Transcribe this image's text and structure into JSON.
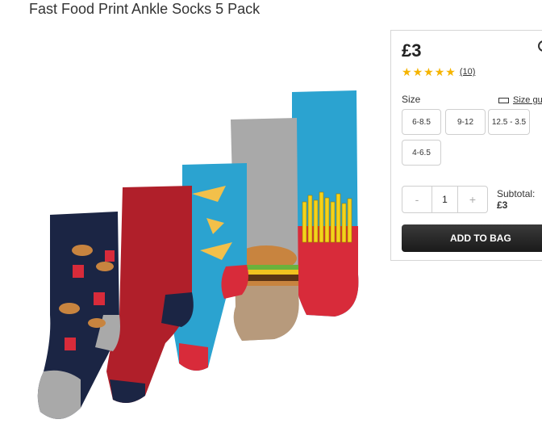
{
  "product": {
    "title": "Fast Food Print Ankle Socks 5 Pack",
    "price": "£3",
    "review_count": "(10)",
    "rating_stars": 5
  },
  "icons": [
    "star-icon",
    "ruler-icon",
    "minus-icon",
    "plus-icon"
  ],
  "size": {
    "label": "Size",
    "guide_label": "Size gu",
    "options": [
      "6-8.5",
      "9-12",
      "12.5 - 3.5",
      "4-6.5"
    ]
  },
  "quantity": {
    "minus": "-",
    "value": "1",
    "plus": "+"
  },
  "subtotal": {
    "label": "Subtotal:",
    "amount": "£3"
  },
  "add_to_bag": "ADD TO BAG",
  "colors": {
    "button_dark": "#222222",
    "star": "#f5b400",
    "sock_navy": "#1b2544",
    "sock_red": "#c8222e",
    "sock_blue": "#2ba3d0",
    "sock_grey": "#a9a9a9",
    "sock_tan": "#b79a7c"
  }
}
